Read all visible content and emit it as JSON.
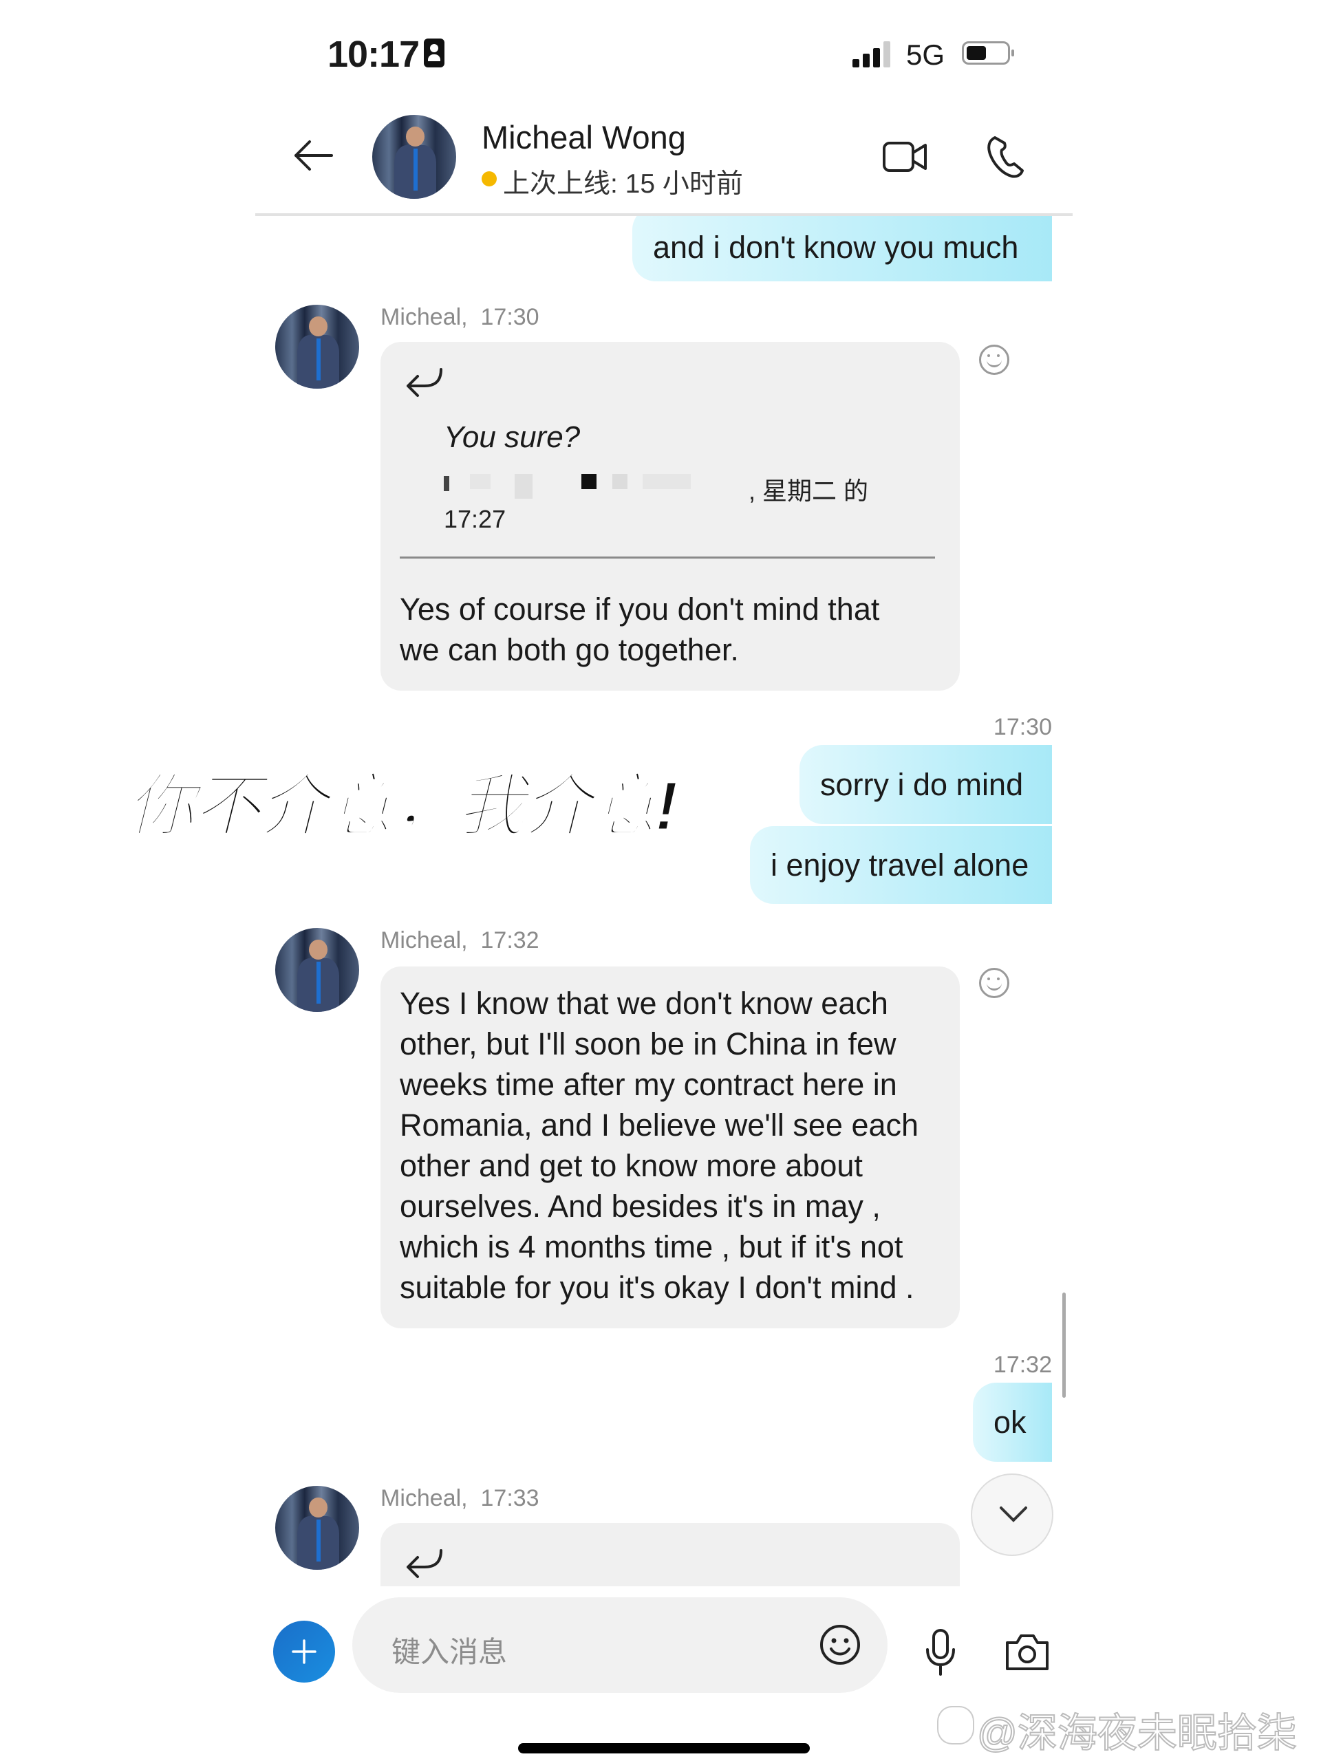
{
  "status_bar": {
    "time": "10:17",
    "network": "5G",
    "battery_level": 0.45
  },
  "header": {
    "contact_name": "Micheal Wong",
    "last_seen": "上次上线: 15 小时前",
    "presence_color": "#f5b800"
  },
  "messages": [
    {
      "direction": "sent",
      "text": "and i don't know you much"
    },
    {
      "direction": "received",
      "sender_meta": "Micheal,  17:30",
      "quote": {
        "text": "You sure?",
        "meta": ", 星期二 的",
        "time": "17:27"
      },
      "text": "Yes of course if you don't mind that\nwe can both go together."
    },
    {
      "direction": "sent",
      "timestamp": "17:30",
      "text": "sorry i do mind"
    },
    {
      "direction": "sent",
      "text": "i enjoy travel alone"
    },
    {
      "direction": "received",
      "sender_meta": "Micheal,  17:32",
      "text": "Yes I know that we don't know each\nother, but I'll soon be in China in few\nweeks time after my contract here in\nRomania, and I believe we'll see each\nother and get to know more about\nourselves. And besides it's in may ,\nwhich is 4 months time , but if it's not\nsuitable for you it's okay I don't mind ."
    },
    {
      "direction": "sent",
      "timestamp": "17:32",
      "text": "ok"
    },
    {
      "direction": "received",
      "sender_meta": "Micheal,  17:33"
    }
  ],
  "caption": "你不介意，我介意!",
  "composer": {
    "placeholder": "键入消息"
  },
  "watermark": "@深海夜未眠拾柒",
  "colors": {
    "accent": "#1a7fd4",
    "sent_bubble": "#b4ecf8",
    "received_bubble": "#f0f0f0"
  }
}
